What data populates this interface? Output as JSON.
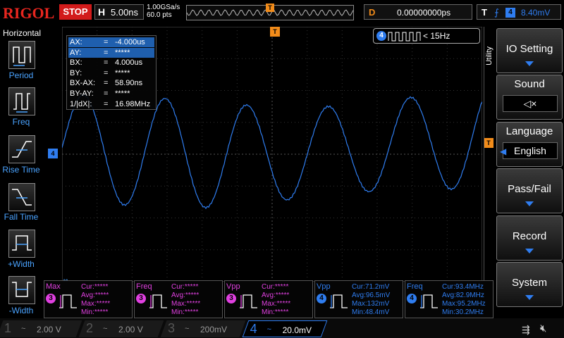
{
  "header": {
    "logo": "RIGOL",
    "run_state": "STOP",
    "horizontal_label": "H",
    "timebase": "5.00ns",
    "sample_rate": "1.00GSa/s",
    "memory_depth": "60.0 pts",
    "trigger_position_marker": "T",
    "delay_label": "D",
    "delay_value": "0.00000000ps",
    "trigger_label": "T",
    "trigger_slope_icon": "rising-edge-icon",
    "trigger_channel": "4",
    "trigger_level": "8.40mV"
  },
  "left_panel": {
    "title": "Horizontal",
    "buttons": [
      {
        "label": "Period",
        "icon": "period-icon"
      },
      {
        "label": "Freq",
        "icon": "frequency-icon"
      },
      {
        "label": "Rise Time",
        "icon": "rise-time-icon"
      },
      {
        "label": "Fall Time",
        "icon": "fall-time-icon"
      },
      {
        "label": "+Width",
        "icon": "positive-width-icon"
      },
      {
        "label": "-Width",
        "icon": "negative-width-icon"
      }
    ]
  },
  "cursors": [
    {
      "key": "AX:",
      "eq": "=",
      "value": "-4.000us",
      "selected": true
    },
    {
      "key": "AY:",
      "eq": "=",
      "value": "*****",
      "selected": true
    },
    {
      "key": "BX:",
      "eq": "=",
      "value": "4.000us",
      "selected": false
    },
    {
      "key": "BY:",
      "eq": "=",
      "value": "*****",
      "selected": false
    },
    {
      "key": "BX-AX:",
      "eq": "=",
      "value": "58.90ns",
      "selected": false
    },
    {
      "key": "BY-AY:",
      "eq": "=",
      "value": "*****",
      "selected": false
    },
    {
      "key": "1/|dX|:",
      "eq": "=",
      "value": "16.98MHz",
      "selected": false
    }
  ],
  "counter": {
    "channel": "4",
    "value": "< 15Hz"
  },
  "markers": {
    "ch4_level": "4",
    "trigger_level": "T",
    "time_origin": "T"
  },
  "utility_label": "Utility",
  "right_panel": [
    {
      "label": "IO Setting",
      "sub": ""
    },
    {
      "label": "Sound",
      "sub": "speaker-mute-icon"
    },
    {
      "label": "Language",
      "sub": "English"
    },
    {
      "label": "Pass/Fail",
      "sub": ""
    },
    {
      "label": "Record",
      "sub": ""
    },
    {
      "label": "System",
      "sub": ""
    }
  ],
  "measurements": [
    {
      "name": "Max",
      "channel": "3",
      "color": "#e040e0",
      "rows": [
        "Cur:*****",
        "Avg:*****",
        "Max:*****",
        "Min:*****"
      ]
    },
    {
      "name": "Freq",
      "channel": "3",
      "color": "#e040e0",
      "rows": [
        "Cur:*****",
        "Avg:*****",
        "Max:*****",
        "Min:*****"
      ]
    },
    {
      "name": "Vpp",
      "channel": "3",
      "color": "#e040e0",
      "rows": [
        "Cur:*****",
        "Avg:*****",
        "Max:*****",
        "Min:*****"
      ]
    },
    {
      "name": "Vpp",
      "channel": "4",
      "color": "#2f7df0",
      "rows": [
        "Cur:71.2mV",
        "Avg:96.5mV",
        "Max:132mV",
        "Min:48.4mV"
      ]
    },
    {
      "name": "Freq",
      "channel": "4",
      "color": "#2f7df0",
      "rows": [
        "Cur:93.4MHz",
        "Avg:82.9MHz",
        "Max:95.2MHz",
        "Min:30.2MHz"
      ]
    }
  ],
  "channels": [
    {
      "num": "1",
      "coupling": "~",
      "scale": "2.00 V",
      "color": "#c9c92a",
      "active": false
    },
    {
      "num": "2",
      "coupling": "~",
      "scale": "2.00 V",
      "color": "#2ac9c9",
      "active": false
    },
    {
      "num": "3",
      "coupling": "~",
      "scale": "200mV",
      "color": "#c92ac9",
      "active": false
    },
    {
      "num": "4",
      "coupling": "~",
      "scale": "20.0mV",
      "color": "#2f7df0",
      "active": true
    }
  ],
  "status_icons": [
    "usb-icon",
    "speaker-mute-icon"
  ],
  "colors": {
    "ch4": "#2f7df0",
    "ch3": "#e040e0",
    "trigger": "#f28c1a",
    "brand": "#e8261f",
    "stop": "#d21b1b"
  }
}
